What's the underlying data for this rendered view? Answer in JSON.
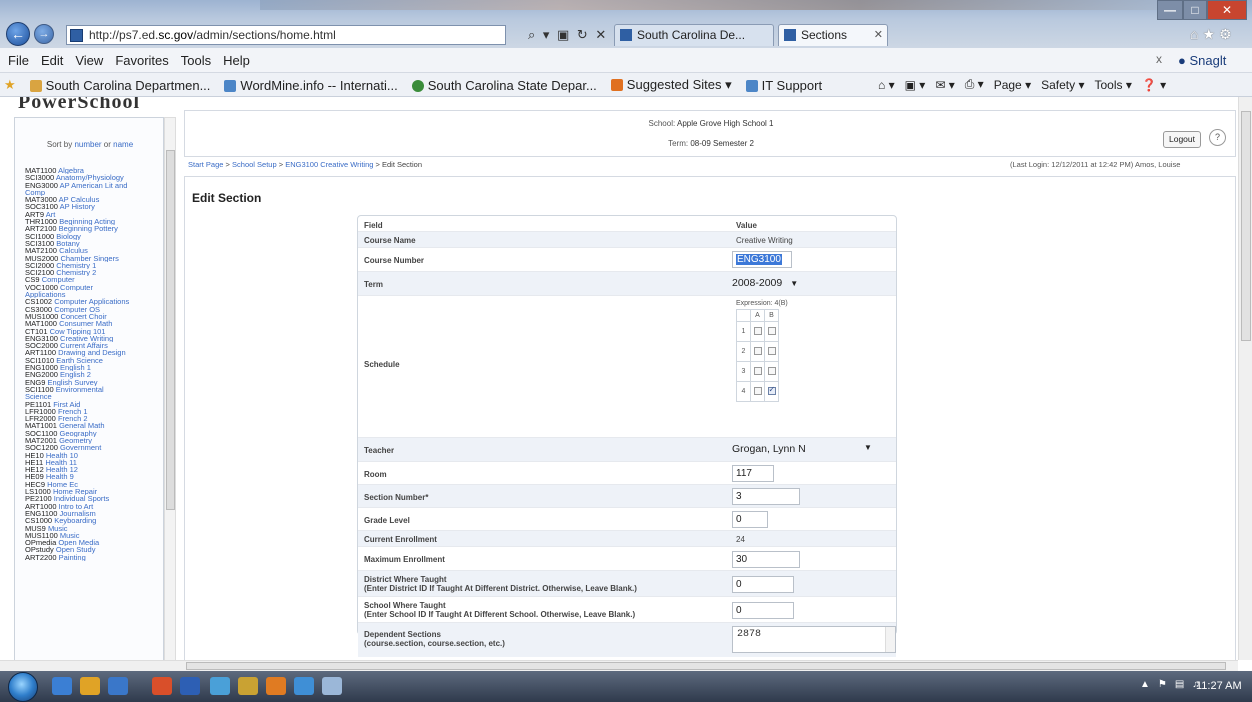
{
  "browser": {
    "url_prefix": "http://ps7.ed.",
    "url_domain": "sc.gov",
    "url_suffix": "/admin/sections/home.html",
    "address_tools": "⌕ ▾ ▣ ↻ ✕",
    "tabs": [
      {
        "label": "South Carolina De...",
        "active": false
      },
      {
        "label": "Sections",
        "active": true
      }
    ],
    "menu": [
      "File",
      "Edit",
      "View",
      "Favorites",
      "Tools",
      "Help"
    ],
    "snagit_label": "Snaglt",
    "favorites": [
      {
        "label": "South Carolina Departmen...",
        "color": "#d9a441"
      },
      {
        "label": "WordMine.info -- Internati...",
        "color": "#4d86c7"
      },
      {
        "label": "South Carolina State Depar...",
        "color": "#3a8c3a"
      },
      {
        "label": "Suggested Sites ▾",
        "color": "#e07020"
      },
      {
        "label": "IT Support",
        "color": "#4d86c7"
      }
    ],
    "command_bar": [
      "⌂ ▾",
      "▣ ▾",
      "✉ ▾",
      "⎙ ▾",
      "Page ▾",
      "Safety ▾",
      "Tools ▾",
      "❓ ▾"
    ]
  },
  "app": {
    "logo": "PowerSchool",
    "sort_prefix": "Sort by ",
    "sort_number": "number",
    "sort_or": " or ",
    "sort_name": "name",
    "courses": [
      {
        "code": "MAT1100",
        "name": "Algebra"
      },
      {
        "code": "SCI3000",
        "name": "Anatomy/Physiology"
      },
      {
        "code": "ENG3000",
        "name": "AP American Lit and"
      },
      {
        "code": "",
        "name": "Comp"
      },
      {
        "code": "MAT3000",
        "name": "AP Calculus"
      },
      {
        "code": "SOC3100",
        "name": "AP History"
      },
      {
        "code": "ART9",
        "name": "Art"
      },
      {
        "code": "THR1000",
        "name": "Beginning Acting"
      },
      {
        "code": "ART2100",
        "name": "Beginning Pottery"
      },
      {
        "code": "SCI1000",
        "name": "Biology"
      },
      {
        "code": "SCI3100",
        "name": "Botany"
      },
      {
        "code": "MAT2100",
        "name": "Calculus"
      },
      {
        "code": "MUS2000",
        "name": "Chamber Singers"
      },
      {
        "code": "SCI2000",
        "name": "Chemistry 1"
      },
      {
        "code": "SCI2100",
        "name": "Chemistry 2"
      },
      {
        "code": "CS9",
        "name": "Computer"
      },
      {
        "code": "VOC1000",
        "name": "Computer"
      },
      {
        "code": "",
        "name": "Applications"
      },
      {
        "code": "CS1002",
        "name": "Computer Applications"
      },
      {
        "code": "CS3000",
        "name": "Computer OS"
      },
      {
        "code": "MUS1000",
        "name": "Concert Choir"
      },
      {
        "code": "MAT1000",
        "name": "Consumer Math"
      },
      {
        "code": "CT101",
        "name": "Cow Tipping 101"
      },
      {
        "code": "ENG3100",
        "name": "Creative Writing"
      },
      {
        "code": "SOC2000",
        "name": "Current Affairs"
      },
      {
        "code": "ART1100",
        "name": "Drawing and Design"
      },
      {
        "code": "SCI1010",
        "name": "Earth Science"
      },
      {
        "code": "ENG1000",
        "name": "English 1"
      },
      {
        "code": "ENG2000",
        "name": "English 2"
      },
      {
        "code": "ENG9",
        "name": "English Survey"
      },
      {
        "code": "SCI1100",
        "name": "Environmental"
      },
      {
        "code": "",
        "name": "Science"
      },
      {
        "code": "PE1101",
        "name": "First Aid"
      },
      {
        "code": "LFR1000",
        "name": "French 1"
      },
      {
        "code": "LFR2000",
        "name": "French 2"
      },
      {
        "code": "MAT1001",
        "name": "General Math"
      },
      {
        "code": "SOC1100",
        "name": "Geography"
      },
      {
        "code": "MAT2001",
        "name": "Geometry"
      },
      {
        "code": "SOC1200",
        "name": "Government"
      },
      {
        "code": "HE10",
        "name": "Health 10"
      },
      {
        "code": "HE11",
        "name": "Health 11"
      },
      {
        "code": "HE12",
        "name": "Health 12"
      },
      {
        "code": "HE09",
        "name": "Health 9"
      },
      {
        "code": "HEC9",
        "name": "Home Ec"
      },
      {
        "code": "LS1000",
        "name": "Home Repair"
      },
      {
        "code": "PE2100",
        "name": "Individual Sports"
      },
      {
        "code": "ART1000",
        "name": "Intro to Art"
      },
      {
        "code": "ENG1100",
        "name": "Journalism"
      },
      {
        "code": "CS1000",
        "name": "Keyboarding"
      },
      {
        "code": "MUS9",
        "name": "Music"
      },
      {
        "code": "MUS1100",
        "name": "Music"
      },
      {
        "code": "OPmedia",
        "name": "Open Media"
      },
      {
        "code": "OPstudy",
        "name": "Open Study"
      },
      {
        "code": "ART2200",
        "name": "Painting"
      }
    ],
    "school_label": "School:",
    "school_value": "Apple Grove High School 1",
    "term_label": "Term:",
    "term_value": "08-09 Semester 2",
    "logout": "Logout",
    "help": "?",
    "breadcrumb": [
      "Start Page",
      "School Setup",
      "ENG3100 Creative Writing"
    ],
    "breadcrumb_current": "Edit Section",
    "breadcrumb_sep": " > ",
    "last_login": "(Last Login: 12/12/2011 at 12:42 PM) Amos, Louise",
    "page_title": "Edit Section"
  },
  "form": {
    "header_field": "Field",
    "header_value": "Value",
    "course_name_label": "Course Name",
    "course_name_value": "Creative Writing",
    "course_number_label": "Course Number",
    "course_number_value": "ENG3100",
    "term_label": "Term",
    "term_value": "2008-2009",
    "schedule_label": "Schedule",
    "schedule_expression": "Expression: 4(B)",
    "schedule_days": [
      "A",
      "B"
    ],
    "schedule_periods": [
      "1",
      "2",
      "3",
      "4"
    ],
    "schedule_checked": [
      [
        false,
        false
      ],
      [
        false,
        false
      ],
      [
        false,
        false
      ],
      [
        false,
        true
      ]
    ],
    "teacher_label": "Teacher",
    "teacher_value": "Grogan, Lynn N",
    "room_label": "Room",
    "room_value": "117",
    "section_number_label": "Section Number*",
    "section_number_value": "3",
    "grade_level_label": "Grade Level",
    "grade_level_value": "0",
    "current_enrollment_label": "Current Enrollment",
    "current_enrollment_value": "24",
    "max_enrollment_label": "Maximum Enrollment",
    "max_enrollment_value": "30",
    "district_label": "District Where Taught",
    "district_sub": "(Enter District ID If Taught At Different District. Otherwise, Leave Blank.)",
    "district_value": "0",
    "school_label": "School Where Taught",
    "school_sub": "(Enter School ID If Taught At Different School. Otherwise, Leave Blank.)",
    "school_value": "0",
    "dependent_label": "Dependent Sections",
    "dependent_sub": "(course.section, course.section, etc.)",
    "dependent_value": "2878"
  },
  "taskbar": {
    "clock": "11:27 AM",
    "icons": [
      "#3b7fd4",
      "#e0a326",
      "#3a77c9",
      "#d94f2a",
      "#2d5fb4",
      "#4aa0d8",
      "#c9a233",
      "#e07b22",
      "#3f8fd6",
      "#9bb7d8"
    ]
  }
}
